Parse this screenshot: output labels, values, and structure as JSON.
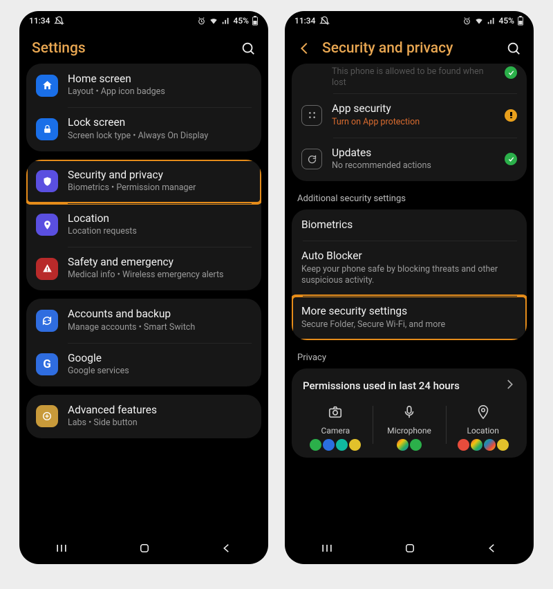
{
  "status": {
    "time": "11:34",
    "battery": "45%"
  },
  "phone1": {
    "title": "Settings",
    "items": [
      {
        "title": "Home screen",
        "sub": "Layout  •  App icon badges",
        "color": "#1a6fe8",
        "icon": "home"
      },
      {
        "title": "Lock screen",
        "sub": "Screen lock type  •  Always On Display",
        "color": "#1a6fe8",
        "icon": "lock"
      },
      {
        "title": "Security and privacy",
        "sub": "Biometrics  •  Permission manager",
        "color": "#5a4fe0",
        "icon": "shield",
        "hl": true
      },
      {
        "title": "Location",
        "sub": "Location requests",
        "color": "#5a4fe0",
        "icon": "pin"
      },
      {
        "title": "Safety and emergency",
        "sub": "Medical info  •  Wireless emergency alerts",
        "color": "#b82a2a",
        "icon": "alert"
      },
      {
        "title": "Accounts and backup",
        "sub": "Manage accounts  •  Smart Switch",
        "color": "#2f6de0",
        "icon": "sync"
      },
      {
        "title": "Google",
        "sub": "Google services",
        "color": "#2f6de0",
        "icon": "g"
      },
      {
        "title": "Advanced features",
        "sub": "Labs  •  Side button",
        "color": "#c89a3a",
        "icon": "plus"
      }
    ]
  },
  "phone2": {
    "title": "Security and privacy",
    "cutoff": {
      "sub": "This phone is allowed to be found when lost"
    },
    "items_top": [
      {
        "title": "App security",
        "sub": "Turn on App protection",
        "subwarn": true,
        "status": "amber",
        "icon": "grid"
      },
      {
        "title": "Updates",
        "sub": "No recommended actions",
        "status": "green",
        "icon": "refresh"
      }
    ],
    "section1": "Additional security settings",
    "items_mid": [
      {
        "title": "Biometrics",
        "sub": ""
      },
      {
        "title": "Auto Blocker",
        "sub": "Keep your phone safe by blocking threats and other suspicious activity."
      },
      {
        "title": "More security settings",
        "sub": "Secure Folder, Secure Wi-Fi, and more",
        "hl": true
      }
    ],
    "section2": "Privacy",
    "perm_title": "Permissions used in last 24 hours",
    "perm_cols": [
      {
        "label": "Camera"
      },
      {
        "label": "Microphone"
      },
      {
        "label": "Location"
      }
    ]
  }
}
